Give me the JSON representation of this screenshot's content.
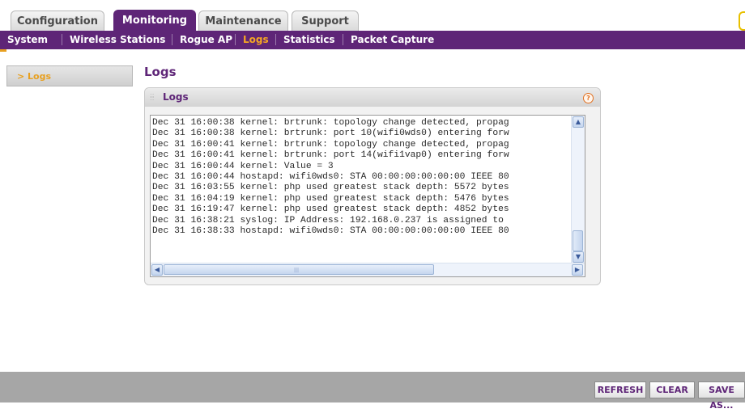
{
  "tabs": [
    {
      "label": "Configuration"
    },
    {
      "label": "Monitoring"
    },
    {
      "label": "Maintenance"
    },
    {
      "label": "Support"
    }
  ],
  "subnav": [
    {
      "label": "System"
    },
    {
      "label": "Wireless Stations"
    },
    {
      "label": "Rogue AP"
    },
    {
      "label": "Logs"
    },
    {
      "label": "Statistics"
    },
    {
      "label": "Packet Capture"
    }
  ],
  "sidebar": {
    "active_item": "> Logs"
  },
  "page_title": "Logs",
  "panel": {
    "title": "Logs",
    "help_glyph": "?"
  },
  "log_lines": [
    "Dec 31 16:00:38 kernel: brtrunk: topology change detected, propag",
    "Dec 31 16:00:38 kernel: brtrunk: port 10(wifi0wds0) entering forw",
    "Dec 31 16:00:41 kernel: brtrunk: topology change detected, propag",
    "Dec 31 16:00:41 kernel: brtrunk: port 14(wifi1vap0) entering forw",
    "Dec 31 16:00:44 kernel: Value = 3",
    "Dec 31 16:00:44 hostapd: wifi0wds0: STA 00:00:00:00:00:00 IEEE 80",
    "Dec 31 16:03:55 kernel: php used greatest stack depth: 5572 bytes",
    "Dec 31 16:04:19 kernel: php used greatest stack depth: 5476 bytes",
    "Dec 31 16:19:47 kernel: php used greatest stack depth: 4852 bytes",
    "Dec 31 16:38:21 syslog: IP Address: 192.168.0.237 is assigned to",
    "Dec 31 16:38:33 hostapd: wifi0wds0: STA 00:00:00:00:00:00 IEEE 80"
  ],
  "scroll": {
    "up": "▲",
    "down": "▼",
    "left": "◀",
    "right": "▶",
    "grip": "|||"
  },
  "buttons": {
    "refresh": "REFRESH",
    "clear": "CLEAR",
    "save_as": "SAVE AS..."
  },
  "colors": {
    "brand_purple": "#5e2577",
    "accent_orange": "#e8a020"
  }
}
